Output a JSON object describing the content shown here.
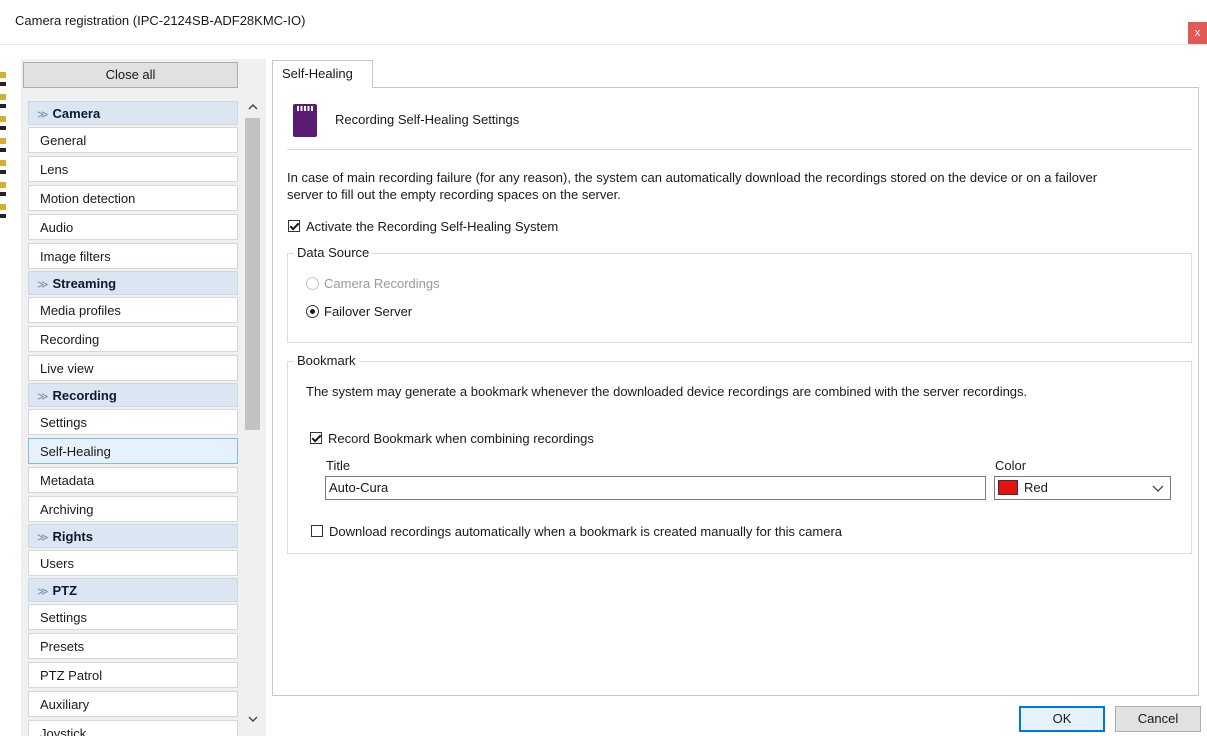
{
  "window": {
    "title": "Camera registration (IPC-2124SB-ADF28KMC-IO)",
    "close_glyph": "x"
  },
  "sidebar": {
    "close_all_label": "Close all",
    "sections": [
      {
        "label": "Camera",
        "items": [
          "General",
          "Lens",
          "Motion detection",
          "Audio",
          "Image filters"
        ]
      },
      {
        "label": "Streaming",
        "items": [
          "Media profiles",
          "Recording",
          "Live view"
        ]
      },
      {
        "label": "Recording",
        "items": [
          "Settings",
          "Self-Healing",
          "Metadata",
          "Archiving"
        ]
      },
      {
        "label": "Rights",
        "items": [
          "Users"
        ]
      },
      {
        "label": "PTZ",
        "items": [
          "Settings",
          "Presets",
          "PTZ Patrol",
          "Auxiliary",
          "Joystick"
        ]
      }
    ],
    "selected_item": "Self-Healing"
  },
  "main": {
    "tab_label": "Self-Healing",
    "heading": "Recording Self-Healing Settings",
    "description_line1": "In case of main recording failure (for any reason), the system can automatically download the recordings stored on the device or on a failover",
    "description_line2": "server to fill out the empty recording spaces on the server.",
    "activate_label": "Activate the Recording Self-Healing System",
    "activate_checked": true,
    "data_source": {
      "label": "Data Source",
      "camera_recordings_label": "Camera Recordings",
      "failover_server_label": "Failover Server",
      "selected": "Failover Server"
    },
    "bookmark": {
      "label": "Bookmark",
      "description": "The system may generate a bookmark whenever the downloaded device recordings are combined with the server recordings.",
      "record_label": "Record Bookmark when combining recordings",
      "record_checked": true,
      "title_label": "Title",
      "title_value": "Auto-Cura",
      "color_label": "Color",
      "color_value": "Red",
      "color_hex": "#e81010",
      "download_label": "Download recordings automatically when a bookmark is created manually for this camera",
      "download_checked": false
    }
  },
  "footer": {
    "ok_label": "OK",
    "cancel_label": "Cancel"
  },
  "icons": [
    "sd-card-icon",
    "chevron-down-icon",
    "scroll-up-icon",
    "scroll-down-icon",
    "close-icon"
  ],
  "colors": {
    "section_header_bg": "#dbe6f2",
    "selected_item_bg": "#e5f1fb",
    "ok_border": "#0078d7",
    "sd_card": "#5b1a73"
  }
}
